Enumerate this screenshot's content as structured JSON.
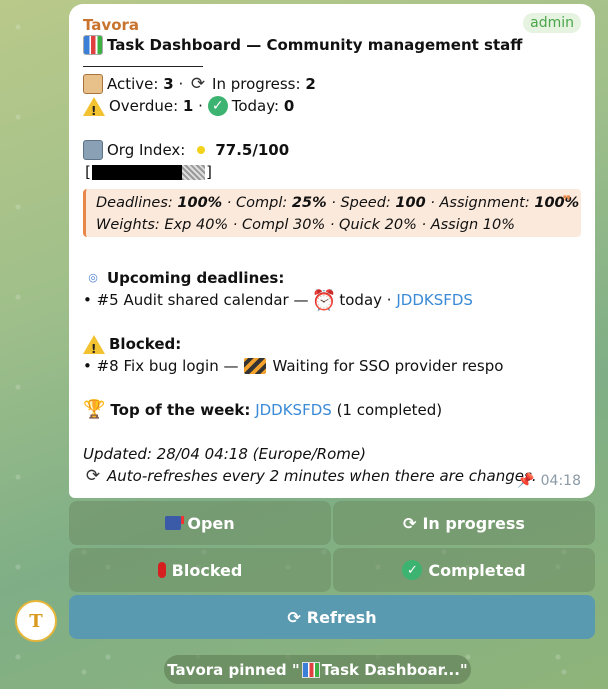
{
  "message": {
    "sender": "Tavora",
    "badge": "admin",
    "title": "Task Dashboard — Community management staff",
    "stats": {
      "active_label": "Active:",
      "active_value": "3",
      "in_progress_label": "In progress:",
      "in_progress_value": "2",
      "overdue_label": "Overdue:",
      "overdue_value": "1",
      "today_label": "Today:",
      "today_value": "0",
      "separator": "·"
    },
    "org_index": {
      "label": "Org Index:",
      "value": "77.5/100",
      "progress_fraction": 0.775,
      "status_color": "#f3d21c"
    },
    "quote": {
      "line1_deadlines_label": "Deadlines:",
      "line1_deadlines_value": "100%",
      "line1_compl_label": "Compl:",
      "line1_compl_value": "25%",
      "line1_speed_label": "Speed:",
      "line1_speed_value": "100",
      "line1_assign_label": "Assignment:",
      "line1_assign_value": "100%",
      "line2": "Weights: Exp 40% · Compl 30% · Quick 20% · Assign 10%",
      "mark": "❞"
    },
    "upcoming": {
      "heading": "Upcoming deadlines:",
      "item_prefix": "• #5 Audit shared calendar —",
      "item_when": "today ·",
      "item_user": "JDDKSFDS"
    },
    "blocked": {
      "heading": "Blocked:",
      "item_prefix": "• #8 Fix bug login —",
      "item_reason": "Waiting for SSO provider respo"
    },
    "top_week": {
      "label": "Top of the week:",
      "user": "JDDKSFDS",
      "suffix": "(1 completed)"
    },
    "updated": "Updated: 28/04 04:18 (Europe/Rome)",
    "auto_refresh": "Auto-refreshes every 2 minutes when there are changes.",
    "time": "04:18"
  },
  "buttons": {
    "open": "Open",
    "in_progress": "In progress",
    "blocked": "Blocked",
    "completed": "Completed",
    "refresh": "Refresh"
  },
  "avatar_letter": "T",
  "service_message": "Tavora pinned \"",
  "service_message_title": "Task Dashboar...\"",
  "colors": {
    "accent_sender": "#c8742e",
    "link": "#3a8ad6",
    "quote_border": "#e8874a",
    "button_refresh": "#5a9ab0"
  }
}
